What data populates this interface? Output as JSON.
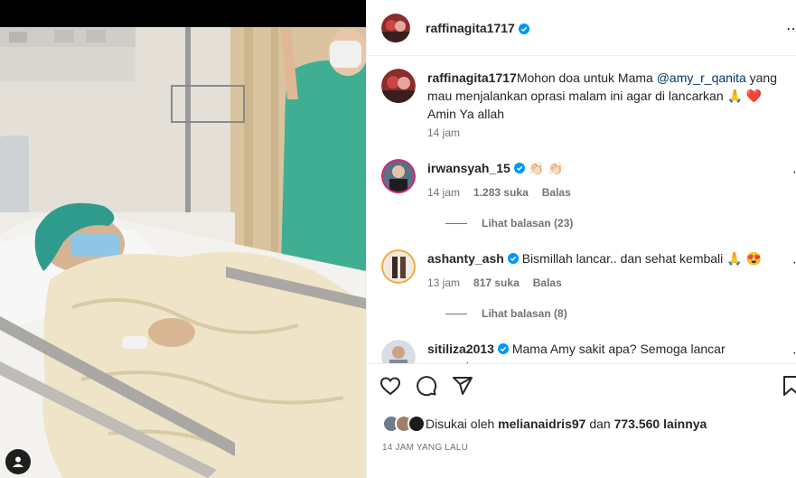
{
  "post": {
    "username": "raffinagita1717",
    "caption_user": "raffinagita1717",
    "caption_text_1": "Mohon doa untuk Mama ",
    "caption_mention": "@amy_r_qanita",
    "caption_text_2": " yang mau menjalankan oprasi malam ini agar di lancarkan 🙏 ❤️  Amin Ya allah",
    "caption_time": "14 jam"
  },
  "comments": [
    {
      "user": "irwansyah_15",
      "text": "👏🏻 👏🏻",
      "time": "14 jam",
      "likes": "1.283 suka",
      "reply": "Balas",
      "view_replies": "Lihat balasan (23)"
    },
    {
      "user": "ashanty_ash",
      "text": "Bismillah lancar.. dan sehat kembali 🙏 😍",
      "time": "13 jam",
      "likes": "817 suka",
      "reply": "Balas",
      "view_replies": "Lihat balasan (8)"
    },
    {
      "user": "sitiliza2013",
      "text": "Mama Amy sakit apa? Semoga lancar operasinya"
    }
  ],
  "likes": {
    "prefix": "Disukai oleh ",
    "first_user": "melianaidris97",
    "middle": " dan ",
    "others": "773.560 lainnya"
  },
  "timestamp": "14 JAM YANG LALU",
  "icons": [
    "heart-icon",
    "comment-icon",
    "share-icon",
    "bookmark-icon",
    "verified-icon",
    "more-icon"
  ],
  "colors": {
    "verified": "#0095f6",
    "mention": "#00376b",
    "muted": "#737373"
  }
}
